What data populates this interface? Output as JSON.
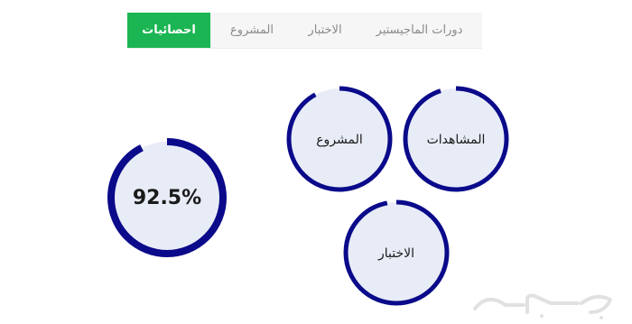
{
  "tabs": [
    {
      "label": "احصائيات",
      "active": true
    },
    {
      "label": "المشروع",
      "active": false
    },
    {
      "label": "الاختبار",
      "active": false
    },
    {
      "label": "دورات الماجيستير",
      "active": false
    }
  ],
  "stats": {
    "overall": {
      "label": "92.5%",
      "progress": 0.925
    },
    "views": {
      "label": "المشاهدات",
      "progress": 0.95
    },
    "project": {
      "label": "المشروع",
      "progress": 0.92
    },
    "exam": {
      "label": "الاختبار",
      "progress": 0.97
    }
  },
  "colors": {
    "accent": "#1bb553",
    "ring": "#0a0a8a",
    "ring_fill": "#e8ecf7",
    "tab_text": "#8a8a8a"
  },
  "watermark": {
    "text": "حراج"
  }
}
